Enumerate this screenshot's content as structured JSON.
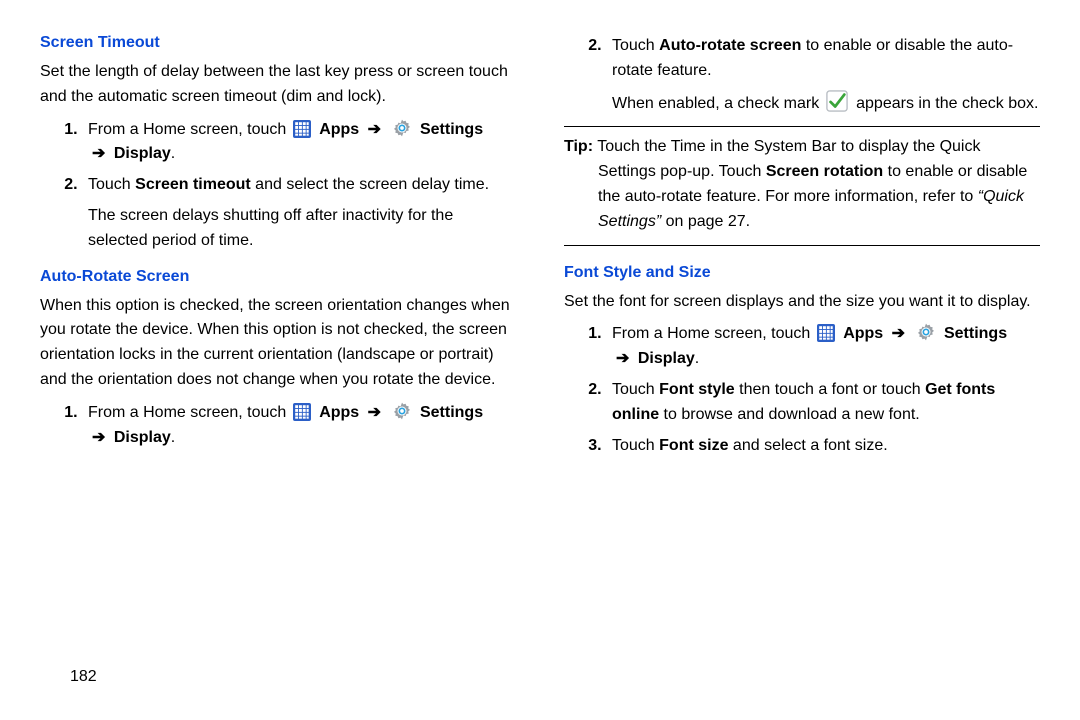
{
  "page_number": "182",
  "left": {
    "screen_timeout": {
      "heading": "Screen Timeout",
      "intro": "Set the length of delay between the last key press or screen touch and the automatic screen timeout (dim and lock).",
      "step1_prefix": "From a Home screen, touch ",
      "apps_label": "Apps",
      "settings_label": "Settings",
      "display_label": "Display",
      "step2_part1": "Touch ",
      "step2_bold": "Screen timeout",
      "step2_part2": " and select the screen delay time.",
      "step2_tail": "The screen delays shutting off after inactivity for the selected period of time."
    },
    "auto_rotate": {
      "heading": "Auto-Rotate Screen",
      "intro": "When this option is checked, the screen orientation changes when you rotate the device. When this option is not checked, the screen orientation locks in the current orientation (landscape or portrait) and the orientation does not change when you rotate the device.",
      "step1_prefix": "From a Home screen, touch ",
      "apps_label": "Apps",
      "settings_label": "Settings",
      "display_label": "Display"
    }
  },
  "right": {
    "auto_rotate_step2": {
      "part1": "Touch ",
      "bold1": "Auto-rotate screen",
      "part2": " to enable or disable the auto-rotate feature.",
      "when_enabled_1": "When enabled, a check mark ",
      "when_enabled_2": " appears in the check box."
    },
    "tip": {
      "label": "Tip:",
      "body1": " Touch the Time in the System Bar to display the Quick Settings pop-up. Touch ",
      "bold": "Screen rotation",
      "body2": " to enable or disable the auto-rotate feature. For more information, refer to ",
      "ref": "“Quick Settings”",
      "body3": " on page 27."
    },
    "font": {
      "heading": "Font Style and Size",
      "intro": "Set the font for screen displays and the size you want it to display.",
      "step1_prefix": "From a Home screen, touch ",
      "apps_label": "Apps",
      "settings_label": "Settings",
      "display_label": "Display",
      "step2_a": "Touch ",
      "step2_b1": "Font style",
      "step2_c": " then touch a font or touch ",
      "step2_b2": "Get fonts online",
      "step2_d": " to browse and download a new font.",
      "step3_a": "Touch ",
      "step3_b": "Font size",
      "step3_c": " and select a font size."
    }
  }
}
